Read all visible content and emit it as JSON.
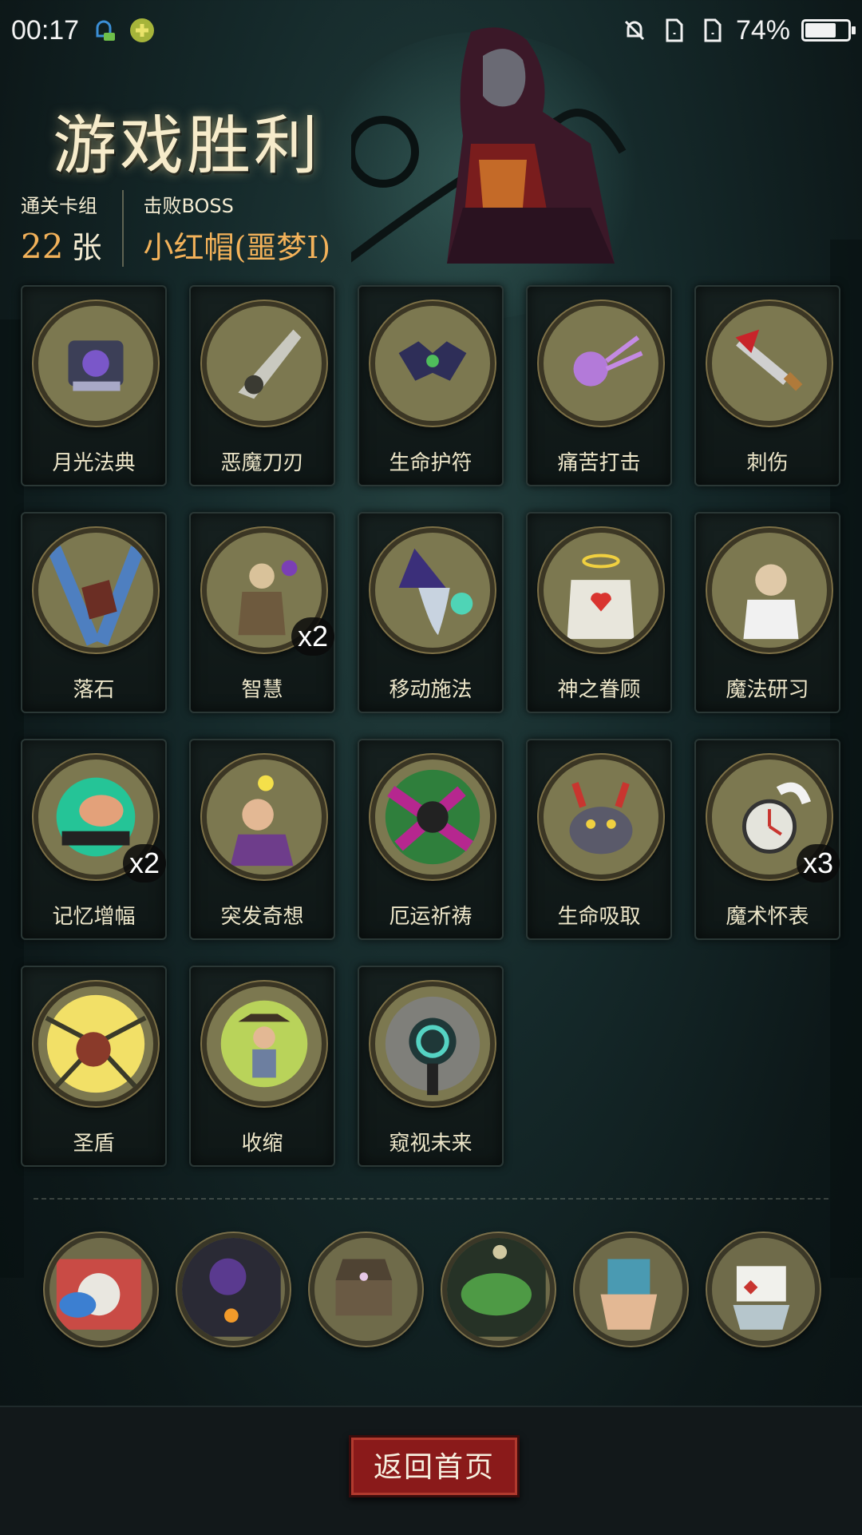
{
  "status_bar": {
    "time": "00:17",
    "battery": "74%",
    "battery_level": 0.74,
    "icons": [
      "notification-app-icon",
      "plus-circle-icon",
      "mute-bell-icon",
      "sim-card-icon",
      "sim-card-icon",
      "battery-icon"
    ]
  },
  "header": {
    "title": "游戏胜利",
    "deck_label": "通关卡组",
    "deck_count": "22",
    "deck_unit": "张",
    "boss_label": "击败BOSS",
    "boss_name": "小红帽(噩梦I)"
  },
  "cards": [
    {
      "name": "月光法典",
      "icon": "spellbook-icon",
      "count": ""
    },
    {
      "name": "恶魔刀刃",
      "icon": "demon-blade-icon",
      "count": ""
    },
    {
      "name": "生命护符",
      "icon": "bat-amulet-icon",
      "count": ""
    },
    {
      "name": "痛苦打击",
      "icon": "skull-strike-icon",
      "count": ""
    },
    {
      "name": "刺伤",
      "icon": "dagger-icon",
      "count": ""
    },
    {
      "name": "落石",
      "icon": "falling-rock-icon",
      "count": ""
    },
    {
      "name": "智慧",
      "icon": "sage-icon",
      "count": "x2"
    },
    {
      "name": "移动施法",
      "icon": "wizard-icon",
      "count": ""
    },
    {
      "name": "神之眷顾",
      "icon": "angel-heart-icon",
      "count": ""
    },
    {
      "name": "魔法研习",
      "icon": "scholar-icon",
      "count": ""
    },
    {
      "name": "记忆增幅",
      "icon": "brain-icon",
      "count": "x2"
    },
    {
      "name": "突发奇想",
      "icon": "idea-bulb-icon",
      "count": ""
    },
    {
      "name": "厄运祈祷",
      "icon": "dark-prayer-icon",
      "count": ""
    },
    {
      "name": "生命吸取",
      "icon": "demon-beast-icon",
      "count": ""
    },
    {
      "name": "魔术怀表",
      "icon": "pocket-watch-icon",
      "count": "x3"
    },
    {
      "name": "圣盾",
      "icon": "holy-shield-icon",
      "count": ""
    },
    {
      "name": "收缩",
      "icon": "shrink-cowboy-icon",
      "count": ""
    },
    {
      "name": "窥视未来",
      "icon": "spiral-eye-icon",
      "count": ""
    }
  ],
  "relics": [
    {
      "icon": "rabbit-relic-icon"
    },
    {
      "icon": "ghost-lantern-relic-icon"
    },
    {
      "icon": "music-box-relic-icon"
    },
    {
      "icon": "green-specter-relic-icon"
    },
    {
      "icon": "card-hand-relic-icon"
    },
    {
      "icon": "playing-cards-relic-icon"
    }
  ],
  "footer": {
    "home_button": "返回首页"
  },
  "colors": {
    "gold_text": "#f3b25a",
    "medal_bg": "#7c7850",
    "button_red": "#8a1a1a"
  }
}
